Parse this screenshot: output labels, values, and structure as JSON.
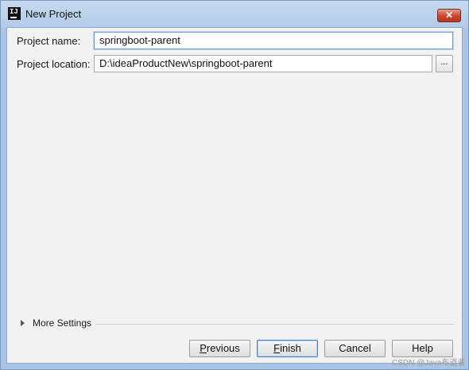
{
  "window": {
    "title": "New Project",
    "close_glyph": "✕",
    "app_icon": {
      "name": "intellij-icon",
      "text": "IJ"
    }
  },
  "form": {
    "project_name": {
      "label": "Project name:",
      "value": "springboot-parent"
    },
    "project_location": {
      "label": "Project location:",
      "value": "D:\\ideaProductNew\\springboot-parent",
      "browse_label": "..."
    }
  },
  "more_settings": {
    "label": "More Settings",
    "expanded": false
  },
  "buttons": {
    "previous": {
      "mnemonic": "P",
      "rest": "revious"
    },
    "finish": {
      "mnemonic": "F",
      "rest": "inish"
    },
    "cancel": "Cancel",
    "help": "Help"
  },
  "watermark": "CSDN @Java布道者",
  "colors": {
    "default_button_border": "#3f7fd0",
    "focused_field_border": "#6f9fd6",
    "close_button": "#c9452d"
  }
}
